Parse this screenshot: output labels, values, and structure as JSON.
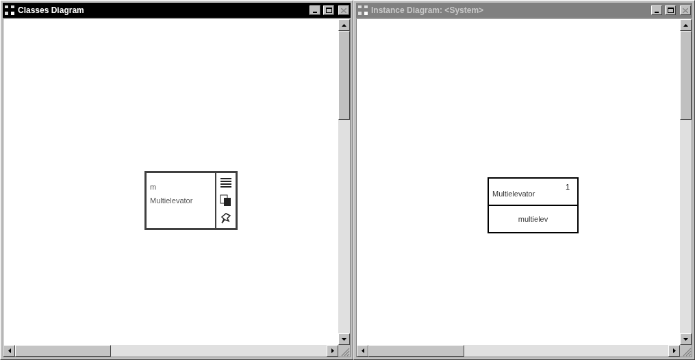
{
  "windows": [
    {
      "title": "Classes Diagram",
      "active": true,
      "nodes": [
        {
          "kind": "class",
          "lines": [
            "m",
            "Multielevator"
          ]
        }
      ]
    },
    {
      "title": "Instance Diagram: <System>",
      "active": false,
      "nodes": [
        {
          "kind": "instance",
          "class_name": "Multielevator",
          "count": "1",
          "instance_name": "multielev"
        }
      ]
    }
  ]
}
